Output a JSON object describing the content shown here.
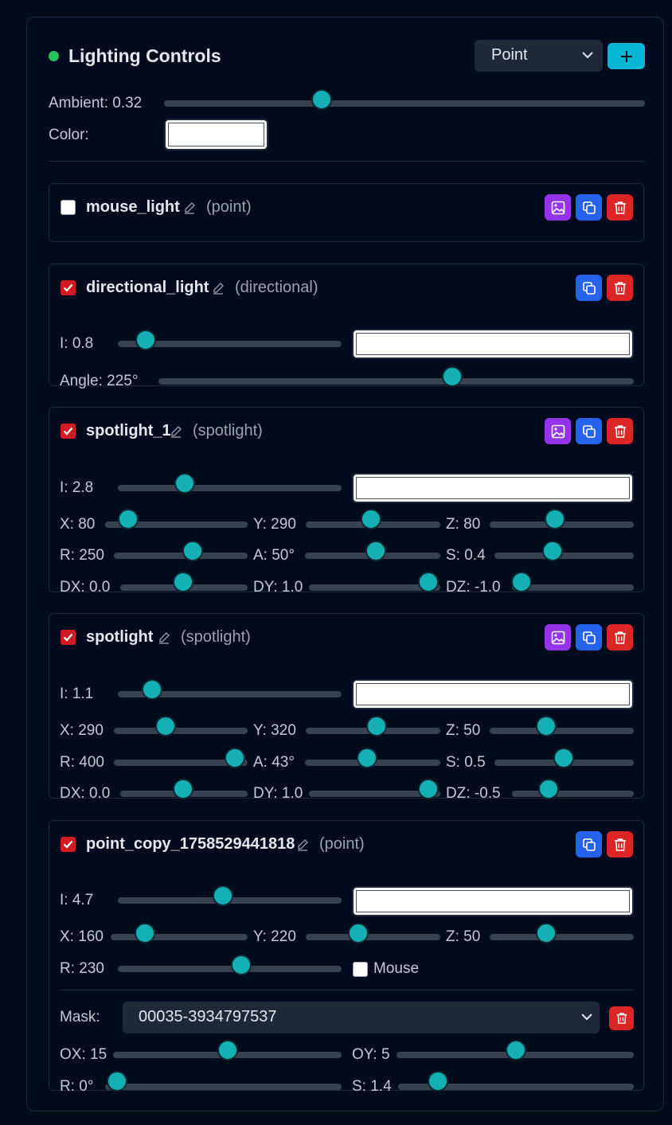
{
  "header": {
    "status_color": "#22c55e",
    "title": "Lighting Controls",
    "type_select_value": "Point",
    "add_button_icon": "plus-icon"
  },
  "global": {
    "ambient_label": "Ambient: 0.32",
    "ambient_value": 0.32,
    "color_label": "Color:",
    "color_value": "#ffffff"
  },
  "lights": [
    {
      "name": "mouse_light",
      "type": "(point)",
      "enabled": false,
      "actions": [
        "image-icon",
        "copy-icon",
        "trash-icon"
      ]
    },
    {
      "name": "directional_light",
      "type": "(directional)",
      "enabled": true,
      "actions": [
        "copy-icon",
        "trash-icon"
      ],
      "intensity_label": "I: 0.8",
      "color_value": "#ffffff",
      "angle_label": "Angle: 225°"
    },
    {
      "name": "spotlight_1",
      "type": "(spotlight)",
      "enabled": true,
      "actions": [
        "image-icon",
        "copy-icon",
        "trash-icon"
      ],
      "intensity_label": "I: 2.8",
      "color_value": "#ffffff",
      "x_label": "X: 80",
      "y_label": "Y: 290",
      "z_label": "Z: 80",
      "r_label": "R: 250",
      "a_label": "A: 50°",
      "s_label": "S: 0.4",
      "dx_label": "DX: 0.0",
      "dy_label": "DY: 1.0",
      "dz_label": "DZ: -1.0"
    },
    {
      "name": "spotlight",
      "type": "(spotlight)",
      "enabled": true,
      "actions": [
        "image-icon",
        "copy-icon",
        "trash-icon"
      ],
      "intensity_label": "I: 1.1",
      "color_value": "#ffffff",
      "x_label": "X: 290",
      "y_label": "Y: 320",
      "z_label": "Z: 50",
      "r_label": "R: 400",
      "a_label": "A: 43°",
      "s_label": "S: 0.5",
      "dx_label": "DX: 0.0",
      "dy_label": "DY: 1.0",
      "dz_label": "DZ: -0.5"
    },
    {
      "name": "point_copy_1758529441818",
      "type": "(point)",
      "enabled": true,
      "actions": [
        "copy-icon",
        "trash-icon"
      ],
      "intensity_label": "I: 4.7",
      "color_value": "#ffffff",
      "x_label": "X: 160",
      "y_label": "Y: 220",
      "z_label": "Z: 50",
      "r_label": "R: 230",
      "mouse_label": "Mouse",
      "mouse_checked": false,
      "mask": {
        "label": "Mask:",
        "value": "00035-3934797537",
        "ox_label": "OX: 15",
        "oy_label": "OY: 5",
        "r_label": "R: 0°",
        "s_label": "S: 1.4"
      }
    }
  ],
  "colors": {
    "accent": "#14b0b4",
    "checkbox_on": "#d11a24",
    "image_button": "#9333ea",
    "copy_button": "#2563eb",
    "delete_button": "#dc2626",
    "add_button": "#06b6d4"
  }
}
